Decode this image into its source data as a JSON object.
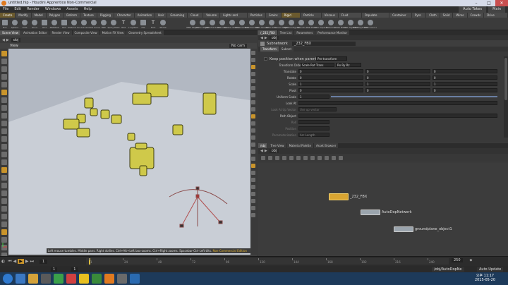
{
  "window": {
    "title": "untitled.hip - Houdini Apprentice Non-Commercial",
    "controls": [
      "–",
      "□",
      "✕"
    ]
  },
  "menubar": {
    "items": [
      "File",
      "Edit",
      "Render",
      "Windows",
      "Assets",
      "Help"
    ],
    "right": [
      "Auto Takes",
      "Main"
    ]
  },
  "shelf_tabs": [
    "Create",
    "Modify",
    "Model",
    "Polygon",
    "Deform",
    "Texture",
    "Rigging",
    "Character",
    "Animation",
    "Hair",
    "Grooming",
    "Cloud FX",
    "Volume",
    "Lights and Cameras",
    "Particles",
    "Grains",
    "Rigid Bodies",
    "Particle Fluids",
    "Viscous FI",
    "Fluid Containers",
    "Populate Containers",
    "Container Tools",
    "Pyro FX",
    "Cloth",
    "Solid",
    "Wires",
    "Crowds",
    "Drive Simulation"
  ],
  "shelf_tools_left": [
    "Box",
    "Sphere",
    "Tube",
    "Torus",
    "Grid",
    "Metaball",
    "Null",
    "Platonic Sol",
    "Curve",
    "Draw Curve",
    "Path",
    "Spray Paint",
    "Text",
    "L-System",
    "File",
    "Font",
    "Stroke"
  ],
  "shelf_tools_right": [
    "RBD Object",
    "Static Object",
    "RBD Fracture",
    "RBD Glue",
    "Rubber Shatter",
    "Ground Plane",
    "RBD Fracture",
    "RBD Aerate",
    "RBD Drive",
    "Terrain Object",
    "RBD Configure",
    "RBD Pin",
    "RBD Point",
    "RBD Impacts",
    "Deformer",
    "Make Break",
    "Glue Adjacent",
    "RBD Keyframe",
    "RBD Cone T"
  ],
  "viewer": {
    "tabs": [
      "Scene View",
      "Animation Editor",
      "Render View",
      "Composite View",
      "Motion FX View",
      "Geometry Spreadsheet"
    ],
    "path": "obj",
    "pane_title": "View",
    "camera": "No cam",
    "hint": "Left mouse tumbles. Middle pans. Right dollies. Ctrl+Alt+Left box-zooms. Ctrl+Right zooms. Spacebar-Ctrl-Left tilts.",
    "nc_badge": "Non-Commercial Edition"
  },
  "params": {
    "tabs": [
      "/_232_FBX",
      "Tree List",
      "Parameters",
      "Performance Monitor"
    ],
    "node_type": "Subnetwork",
    "node_name": "_232_FBX",
    "subtabs": [
      "Transform",
      "Subnet"
    ],
    "keep_position": "Keep position when parenting",
    "pretransform": "Pre-transform",
    "transform_order_label": "Transform Order",
    "transform_order": "Scale Rot Trans",
    "rot_order": "Rx Ry Rz",
    "rows": [
      {
        "label": "Translate",
        "v": [
          "0",
          "0",
          "0"
        ]
      },
      {
        "label": "Rotate",
        "v": [
          "0",
          "0",
          "0"
        ]
      },
      {
        "label": "Scale",
        "v": [
          "1",
          "1",
          "1"
        ]
      },
      {
        "label": "Pivot",
        "v": [
          "0",
          "0",
          "0"
        ]
      }
    ],
    "uniform_scale_label": "Uniform Scale",
    "uniform_scale": "1",
    "lookat_label": "Look At",
    "lookup_label": "Look At Up Vector",
    "lookup_value": "Use up vector",
    "pathobj_label": "Path Object",
    "roll_label": "Roll",
    "position_label": "Position",
    "param_label": "Parameterization",
    "param_value": "Arc Length"
  },
  "network": {
    "tabs": [
      "/obj",
      "Tree View",
      "Material Palette",
      "Asset Browser"
    ],
    "path": "obj",
    "nodes": [
      {
        "name": "_232_FBX",
        "color": "#d9a532"
      },
      {
        "name": "AutoDopNetwork",
        "color": "#9aa4ad"
      },
      {
        "name": "groundplane_object1",
        "color": "#9aa4ad"
      }
    ]
  },
  "timeline": {
    "current_frame": "1",
    "start": "1",
    "end": "1",
    "total": "250",
    "tick_labels": [
      "1",
      "24",
      "48",
      "72",
      "96",
      "120",
      "144",
      "168",
      "192",
      "216",
      "240"
    ],
    "playhead_fraction": 0.0,
    "path_button": "/obj/AutoDopNe",
    "auto_update": "Auto Update"
  },
  "taskbar": {
    "time": "11:17",
    "date": "2015-05-20",
    "ampm": "오후"
  }
}
